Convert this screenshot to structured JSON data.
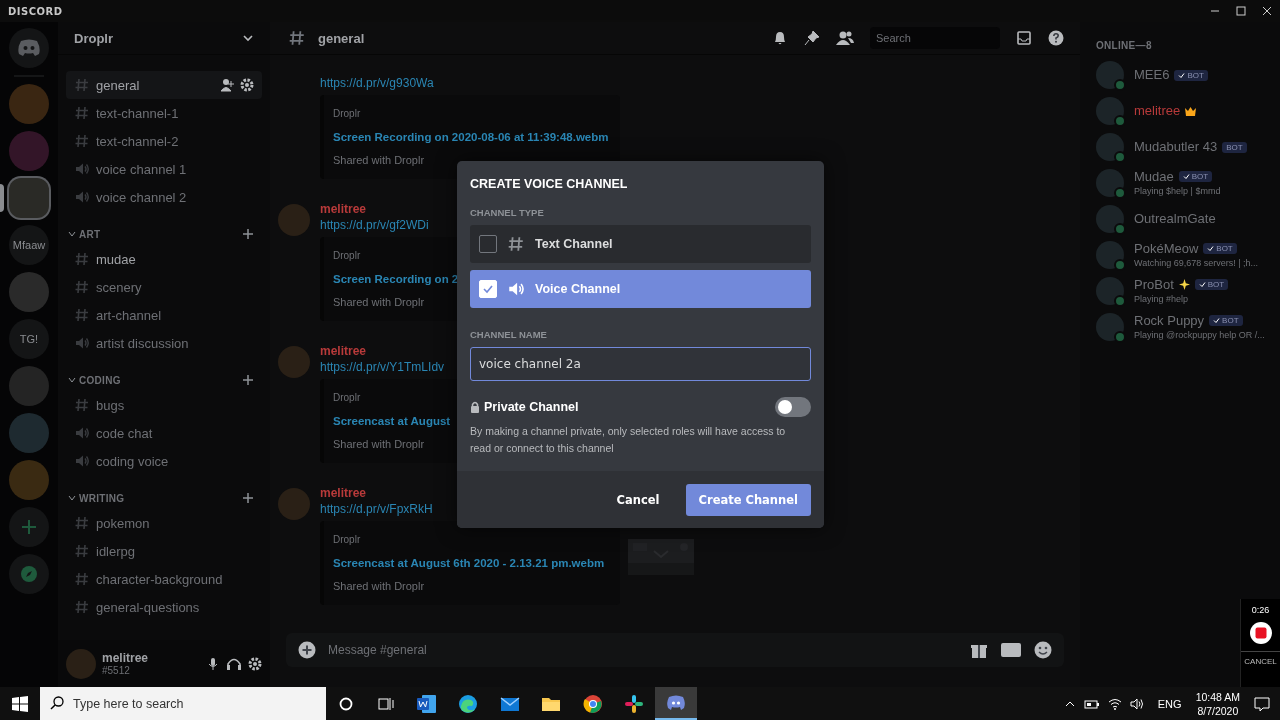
{
  "app_title": "DISCORD",
  "servers": [
    {
      "kind": "home",
      "selected": false
    },
    {
      "kind": "avatar",
      "selected": false
    },
    {
      "kind": "avatar",
      "selected": false
    },
    {
      "kind": "avatar",
      "selected": true
    },
    {
      "kind": "text",
      "label": "Mfaaw",
      "selected": false
    },
    {
      "kind": "avatar",
      "selected": false
    },
    {
      "kind": "text",
      "label": "TG!",
      "selected": false
    },
    {
      "kind": "avatar",
      "selected": false
    },
    {
      "kind": "avatar",
      "selected": false
    },
    {
      "kind": "avatar",
      "selected": false
    },
    {
      "kind": "add",
      "selected": false
    },
    {
      "kind": "explore",
      "selected": false
    }
  ],
  "server_name": "Droplr",
  "channels": [
    {
      "name": "general",
      "kind": "text",
      "selected": true,
      "unread": false
    },
    {
      "name": "text-channel-1",
      "kind": "text",
      "selected": false,
      "unread": false
    },
    {
      "name": "text-channel-2",
      "kind": "text",
      "selected": false,
      "unread": false
    },
    {
      "name": "voice channel 1",
      "kind": "voice",
      "selected": false,
      "unread": false
    },
    {
      "name": "voice channel 2",
      "kind": "voice",
      "selected": false,
      "unread": false
    }
  ],
  "categories": [
    {
      "name": "ART",
      "channels": [
        {
          "name": "mudae",
          "kind": "text",
          "selected": false,
          "unread": true
        },
        {
          "name": "scenery",
          "kind": "text",
          "selected": false,
          "unread": false
        },
        {
          "name": "art-channel",
          "kind": "text",
          "selected": false,
          "unread": false
        },
        {
          "name": "artist discussion",
          "kind": "voice",
          "selected": false,
          "unread": false
        }
      ]
    },
    {
      "name": "CODING",
      "channels": [
        {
          "name": "bugs",
          "kind": "text",
          "selected": false,
          "unread": false
        },
        {
          "name": "code chat",
          "kind": "voice",
          "selected": false,
          "unread": false
        },
        {
          "name": "coding voice",
          "kind": "voice",
          "selected": false,
          "unread": false
        }
      ]
    },
    {
      "name": "WRITING",
      "channels": [
        {
          "name": "pokemon",
          "kind": "text",
          "selected": false,
          "unread": false
        },
        {
          "name": "idlerpg",
          "kind": "text",
          "selected": false,
          "unread": false
        },
        {
          "name": "character-background",
          "kind": "text",
          "selected": false,
          "unread": false
        },
        {
          "name": "general-questions",
          "kind": "text",
          "selected": false,
          "unread": false
        }
      ]
    }
  ],
  "user": {
    "name": "melitree",
    "tag": "#5512"
  },
  "chat": {
    "channel": "general",
    "search_placeholder": "Search",
    "input_placeholder": "Message #general"
  },
  "messages": [
    {
      "link": "https://d.pr/v/g930Wa",
      "embed": {
        "provider": "Droplr",
        "title": "Screen Recording on 2020-08-06 at 11:39:48.webm",
        "footer": "Shared with Droplr"
      }
    },
    {
      "author": "melitree",
      "link": "https://d.pr/v/gf2WDi",
      "embed": {
        "provider": "Droplr",
        "title": "Screen Recording on 2",
        "footer": "Shared with Droplr"
      }
    },
    {
      "author": "melitree",
      "link": "https://d.pr/v/Y1TmLIdv",
      "embed": {
        "provider": "Droplr",
        "title": "Screencast at August",
        "footer": "Shared with Droplr"
      }
    },
    {
      "author": "melitree",
      "link": "https://d.pr/v/FpxRkH",
      "embed": {
        "provider": "Droplr",
        "title": "Screencast at August 6th 2020 - 2.13.21 pm.webm",
        "footer": "Shared with Droplr",
        "thumbnail": true
      }
    }
  ],
  "members_heading": "ONLINE—8",
  "members": [
    {
      "name": "MEE6",
      "color": "#6e7075",
      "badge": "BOT",
      "verified": true,
      "owner": false,
      "sparkle": false
    },
    {
      "name": "melitree",
      "color": "#b83a3a",
      "owner": true,
      "sparkle": false
    },
    {
      "name": "Mudabutler 43",
      "color": "#6e7075",
      "badge": "BOT",
      "verified": false,
      "owner": false,
      "sparkle": false
    },
    {
      "name": "Mudae",
      "color": "#6e7075",
      "badge": "BOT",
      "verified": true,
      "owner": false,
      "sparkle": false,
      "activity": "Playing $help | $mmd"
    },
    {
      "name": "OutrealmGate",
      "color": "#6e7075",
      "owner": false,
      "sparkle": false
    },
    {
      "name": "PokéMeow",
      "color": "#6e7075",
      "badge": "BOT",
      "verified": true,
      "owner": false,
      "sparkle": false,
      "activity": "Watching 69,678 servers! | ;h..."
    },
    {
      "name": "ProBot",
      "color": "#6e7075",
      "badge": "BOT",
      "verified": true,
      "owner": false,
      "sparkle": true,
      "activity": "Playing #help"
    },
    {
      "name": "Rock Puppy",
      "color": "#6e7075",
      "badge": "BOT",
      "verified": true,
      "owner": false,
      "sparkle": false,
      "activity": "Playing @rockpuppy help OR /..."
    }
  ],
  "modal": {
    "title": "CREATE VOICE CHANNEL",
    "type_label": "CHANNEL TYPE",
    "channel_types": [
      {
        "label": "Text Channel",
        "kind": "text",
        "selected": false
      },
      {
        "label": "Voice Channel",
        "kind": "voice",
        "selected": true
      }
    ],
    "name_label": "CHANNEL NAME",
    "name_value": "voice channel 2a",
    "private": {
      "label": "Private Channel",
      "on": false,
      "description": "By making a channel private, only selected roles will have access to read or connect to this channel"
    },
    "cancel": "Cancel",
    "create": "Create Channel"
  },
  "recorder": {
    "time": "0:26",
    "cancel": "CANCEL"
  },
  "taskbar": {
    "search_placeholder": "Type here to search",
    "apps": [
      {
        "kind": "document",
        "active": false
      },
      {
        "kind": "browser",
        "active": false
      },
      {
        "kind": "mail",
        "active": false
      },
      {
        "kind": "folder",
        "active": false
      },
      {
        "kind": "globe",
        "active": false
      },
      {
        "kind": "pinwheel",
        "active": false
      },
      {
        "kind": "chat",
        "active": true
      }
    ],
    "language": "ENG",
    "time": "10:48 AM",
    "date": "8/7/2020"
  }
}
